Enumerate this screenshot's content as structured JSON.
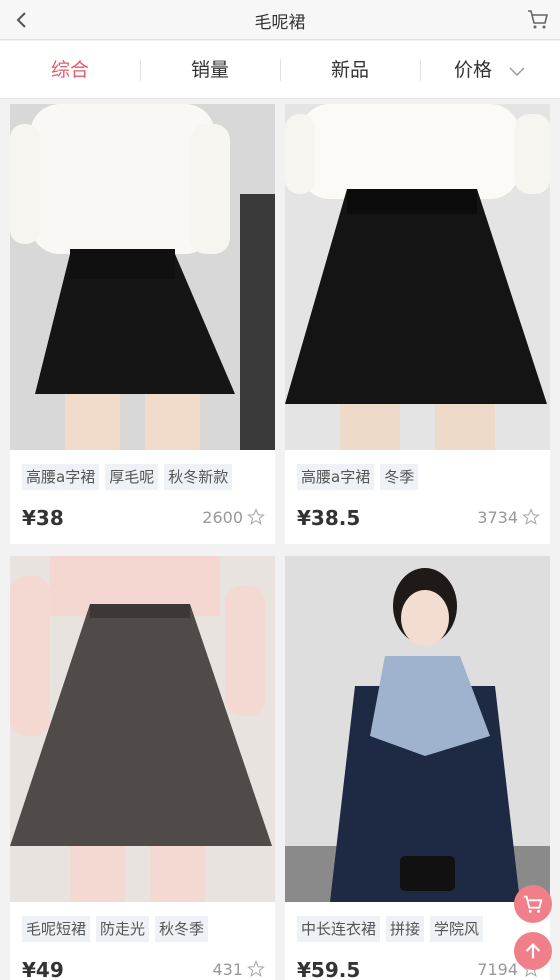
{
  "header": {
    "title": "毛呢裙"
  },
  "tabs": [
    {
      "label": "综合"
    },
    {
      "label": "销量"
    },
    {
      "label": "新品"
    },
    {
      "label": "价格"
    }
  ],
  "colors": {
    "accent": "#e25d6a",
    "fab": "#f07f8a"
  },
  "products": [
    {
      "tags": [
        "高腰a字裙",
        "厚毛呢",
        "秋冬新款"
      ],
      "price": "¥38",
      "sales": "2600"
    },
    {
      "tags": [
        "高腰a字裙",
        "冬季"
      ],
      "price": "¥38.5",
      "sales": "3734"
    },
    {
      "tags": [
        "毛呢短裙",
        "防走光",
        "秋冬季"
      ],
      "price": "¥49",
      "sales": "431"
    },
    {
      "tags": [
        "中长连衣裙",
        "拼接",
        "学院风"
      ],
      "price": "¥59.5",
      "sales": "7194"
    }
  ],
  "floating": {
    "cart_icon": "cart-icon",
    "top_icon": "arrow-up-icon"
  }
}
